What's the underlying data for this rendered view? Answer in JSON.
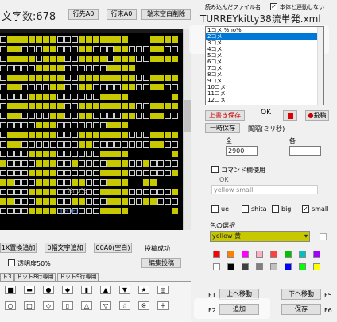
{
  "header": {
    "char_count": "文字数:678",
    "line_start_btn": "行先A0",
    "line_end_btn": "行末A0",
    "trim_btn": "端末空白削除",
    "loaded_file_label": "読み込んだファイル名",
    "sync_label": "本体と連動しない",
    "filename": "TURREYkitty38流単発.xml"
  },
  "editor": {
    "marker_text": "%no%",
    "eof_text": "[EOF]"
  },
  "comment_list": {
    "items": [
      "1コメ %no%",
      "2コメ",
      "3コメ",
      "4コメ",
      "5コメ",
      "6コメ",
      "7コメ",
      "8コメ",
      "9コメ",
      "10コメ",
      "11コメ",
      "12コメ"
    ],
    "selected_index": 1
  },
  "actions": {
    "overwrite_save": "上書き保存",
    "ok": "OK",
    "post": "投稿",
    "temp_save": "一時保存",
    "interval_label": "間隔(ミリ秒)"
  },
  "timing": {
    "all_label": "全",
    "each_label": "各",
    "all_value": "2900",
    "each_value": ""
  },
  "command": {
    "use_label": "コマンド欄使用",
    "ok_label": "OK",
    "value": "yellow small",
    "options": [
      {
        "label": "ue",
        "checked": false
      },
      {
        "label": "shita",
        "checked": false
      },
      {
        "label": "big",
        "checked": false
      },
      {
        "label": "small",
        "checked": true
      }
    ]
  },
  "color": {
    "section_label": "色の選択",
    "selected": "yellow 黄",
    "swatches": [
      "#ff0000",
      "#ff8000",
      "#ff00ff",
      "#ffb0c0",
      "#ff4040",
      "#00c000",
      "#00c0c0",
      "#a000ff",
      "#ffffff",
      "#000000",
      "#404040",
      "#808080",
      "#c0c0c0",
      "#0000ff",
      "#00ff00",
      "#ffff00"
    ]
  },
  "bottom_left": {
    "replace_add": "1X置換追加",
    "zero_width_add": "0幅文字追加",
    "space_btn": "00A0(空白)",
    "post_success": "投稿成功",
    "transparency_label": "透明度50%",
    "edit_post": "編集投稿"
  },
  "tabs": [
    "ト3",
    "ドット8行専用",
    "ドット9行専用"
  ],
  "symbols": [
    "■",
    "▬",
    "●",
    "◆",
    "▮",
    "▲",
    "▼",
    "★",
    "◎",
    "○",
    "□",
    "◇",
    "▯",
    "△",
    "▽",
    "☆",
    "※",
    "＋"
  ],
  "nav": {
    "f1": "F1",
    "up_move": "上へ移動",
    "down_move": "下へ移動",
    "f5": "F5",
    "f2": "F2",
    "add": "追加",
    "save": "保存",
    "f6": "F6"
  }
}
